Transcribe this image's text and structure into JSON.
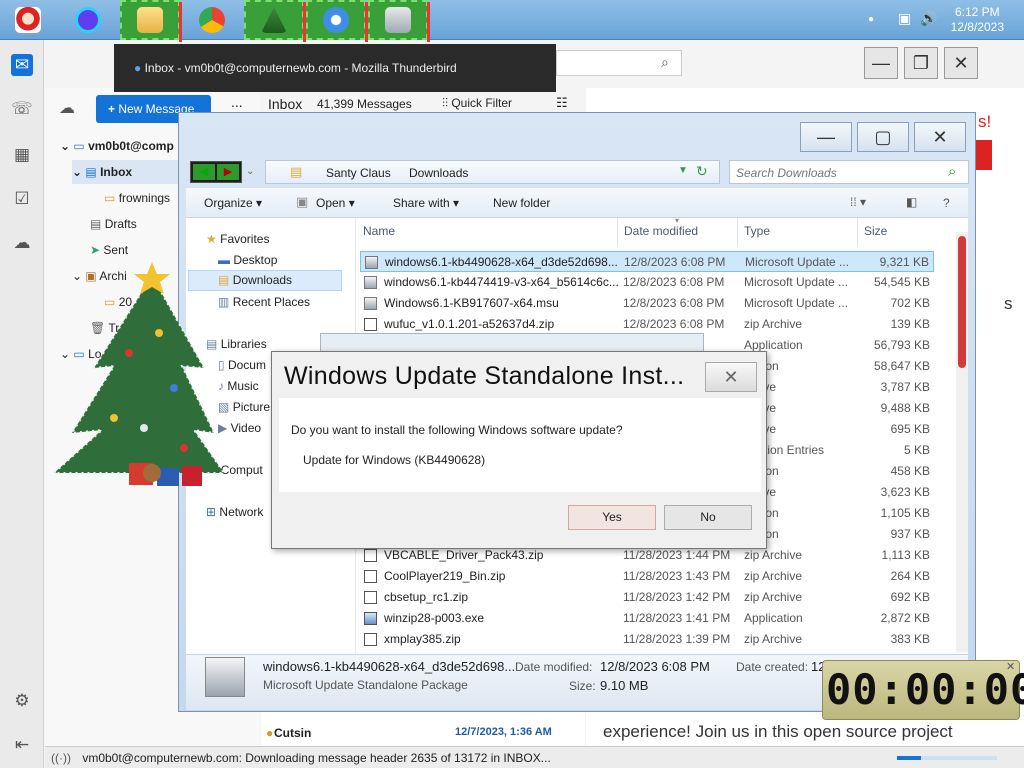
{
  "taskbar": {
    "time": "6:12 PM",
    "date": "12/8/2023"
  },
  "thunderbird": {
    "tooltip": "Inbox - vm0b0t@computernewb.com - Mozilla Thunderbird",
    "new_message": "New Message",
    "more": "...",
    "account": "vm0b0t@computernewb.com",
    "account_short": "vm0b0t@comp",
    "folders": [
      {
        "label": "Inbox"
      },
      {
        "label": "frownings"
      },
      {
        "label": "Drafts"
      },
      {
        "label": "Sent"
      },
      {
        "label": "Archi"
      },
      {
        "label": "20"
      },
      {
        "label": "Tr"
      },
      {
        "label": "Lo"
      }
    ],
    "list_header": {
      "folder": "Inbox",
      "count": "41,399 Messages",
      "quick_filter": "Quick Filter"
    },
    "list_row": {
      "sender": "Cutsin",
      "date": "12/7/2023, 1:36 AM"
    },
    "preview_snippets": [
      "s!",
      "s",
      "experience! Join us in this open source project"
    ],
    "status": "vm0b0t@computernewb.com: Downloading message header 2635 of 13172 in INBOX..."
  },
  "explorer": {
    "breadcrumb": [
      "Santy Claus",
      "Downloads"
    ],
    "search_placeholder": "Search Downloads",
    "toolbar": {
      "organize": "Organize",
      "open": "Open",
      "share": "Share with",
      "new_folder": "New folder"
    },
    "nav": {
      "favorites": "Favorites",
      "desktop": "Desktop",
      "downloads": "Downloads",
      "recent": "Recent Places",
      "libraries": "Libraries",
      "documents": "Docum",
      "music": "Music",
      "pictures": "Picture",
      "videos": "Video",
      "computer": "Comput",
      "network": "Network"
    },
    "columns": {
      "name": "Name",
      "date": "Date modified",
      "type": "Type",
      "size": "Size"
    },
    "files": [
      {
        "name": "windows6.1-kb4490628-x64_d3de52d698...",
        "date": "12/8/2023 6:08 PM",
        "type": "Microsoft Update ...",
        "size": "9,321 KB",
        "icon": "msu-icon"
      },
      {
        "name": "windows6.1-kb4474419-v3-x64_b5614c6c...",
        "date": "12/8/2023 6:08 PM",
        "type": "Microsoft Update ...",
        "size": "54,545 KB",
        "icon": "msu-icon"
      },
      {
        "name": "Windows6.1-KB917607-x64.msu",
        "date": "12/8/2023 6:08 PM",
        "type": "Microsoft Update ...",
        "size": "702 KB",
        "icon": "msu-icon"
      },
      {
        "name": "wufuc_v1.0.1.201-a52637d4.zip",
        "date": "12/8/2023 6:08 PM",
        "type": "zip Archive",
        "size": "139 KB",
        "icon": "zip-icon"
      },
      {
        "name": "",
        "date": "",
        "type": "Application",
        "size": "56,793 KB",
        "icon": ""
      },
      {
        "name": "",
        "date": "",
        "type": "ication",
        "size": "58,647 KB",
        "icon": ""
      },
      {
        "name": "",
        "date": "",
        "type": "rchive",
        "size": "3,787 KB",
        "icon": ""
      },
      {
        "name": "",
        "date": "",
        "type": "rchive",
        "size": "9,488 KB",
        "icon": ""
      },
      {
        "name": "",
        "date": "",
        "type": "rchive",
        "size": "695 KB",
        "icon": ""
      },
      {
        "name": "",
        "date": "",
        "type": "stration Entries",
        "size": "5 KB",
        "icon": ""
      },
      {
        "name": "",
        "date": "",
        "type": "ication",
        "size": "458 KB",
        "icon": ""
      },
      {
        "name": "",
        "date": "",
        "type": "rchive",
        "size": "3,623 KB",
        "icon": ""
      },
      {
        "name": "",
        "date": "",
        "type": "ication",
        "size": "1,105 KB",
        "icon": ""
      },
      {
        "name": "",
        "date": "",
        "type": "ication",
        "size": "937 KB",
        "icon": ""
      },
      {
        "name": "VBCABLE_Driver_Pack43.zip",
        "date": "11/28/2023 1:44 PM",
        "type": "zip Archive",
        "size": "1,113 KB",
        "icon": "zip-icon"
      },
      {
        "name": "CoolPlayer219_Bin.zip",
        "date": "11/28/2023 1:43 PM",
        "type": "zip Archive",
        "size": "264 KB",
        "icon": "zip-icon"
      },
      {
        "name": "cbsetup_rc1.zip",
        "date": "11/28/2023 1:42 PM",
        "type": "zip Archive",
        "size": "692 KB",
        "icon": "zip-icon"
      },
      {
        "name": "winzip28-p003.exe",
        "date": "11/28/2023 1:41 PM",
        "type": "Application",
        "size": "2,872 KB",
        "icon": "exe-icon"
      },
      {
        "name": "xmplay385.zip",
        "date": "11/28/2023 1:39 PM",
        "type": "zip Archive",
        "size": "383 KB",
        "icon": "zip-icon"
      }
    ],
    "details": {
      "name": "windows6.1-kb4490628-x64_d3de52d698...",
      "kind": "Microsoft Update Standalone Package",
      "modified_label": "Date modified:",
      "modified": "12/8/2023 6:08 PM",
      "size_label": "Size:",
      "size": "9.10 MB",
      "created_label": "Date created:",
      "created": "12"
    }
  },
  "dialog": {
    "title": "Windows Update Standalone Inst...",
    "question": "Do you want to install the following Windows software update?",
    "update_name": "Update for Windows (KB4490628)",
    "yes": "Yes",
    "no": "No"
  },
  "timer": {
    "text": "00:00:00"
  },
  "colors": {
    "accent": "#1373d9",
    "selection": "#cde8fb",
    "scroll_thumb": "#d03b3b"
  }
}
